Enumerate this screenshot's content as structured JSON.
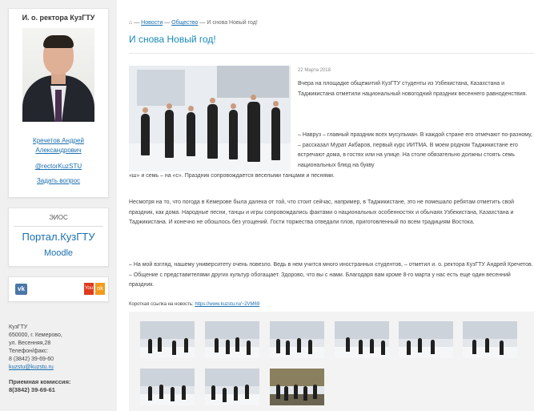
{
  "sidebar": {
    "rector": {
      "title": "И. о. ректора КузГТУ",
      "name_line1": "Кречетов Андрей",
      "name_line2": "Александрович",
      "handle": "@rectorKuzSTU",
      "ask_link": "Задать вопрос"
    },
    "eios": {
      "title": "ЭИОС",
      "portal": "Портал.КузГТУ",
      "moodle": "Moodle"
    },
    "social": {
      "vk": "vk",
      "youtube": "You",
      "ok": "ok"
    },
    "contacts": {
      "org": "КузГТУ",
      "address_line1": "650000, г. Кемерово,",
      "address_line2": "ул. Весенняя,28",
      "phone_label": "Телефон/факс:",
      "phone": "8 (3842) 39-69-60",
      "email": "kuzstu@kuzstu.ru",
      "admissions_label": "Приемная комиссия:",
      "admissions_phone": "8(3842) 39-69-61"
    }
  },
  "breadcrumb": {
    "home_icon": "home-icon",
    "sep": "—",
    "items": [
      "Новости",
      "Общество",
      "И снова Новый год!"
    ]
  },
  "article": {
    "title": "И снова Новый год!",
    "date": "22 Марта 2018",
    "p1": "Вчера на площадке общежитий КузГТУ студенты из Узбекистана, Казахстана и Таджикистана отметили национальный новогодний праздник весеннего равноденствия.",
    "p2": "– Навруз – главный праздник всех мусульман. В каждой стране его отмечают по-разному, – рассказал Мурат Акбаров, первый курс ИИТМА. В моем родном Таджикистане его встречают дома, в гостях или на улице. На столе обязательно должны стоять семь национальных блюд на букву",
    "p2_tail": "«ш» и семь – на «с». Праздник сопровождается веселыми танцами и песнями.",
    "p3": "Несмотря на то, что погода в Кемерове была далека от той, что стоит сейчас, например, в Таджикистане, это не помешало ребятам отметить свой праздник, как дома. Народные песни, танцы и игры сопровождались фактами о национальных особенностях и обычаях Узбекистана, Казахстана и Таджикистана. И конечно не обошлось без угощений. Гости торжества отведали плов, приготовленный по всем традициям Востока.",
    "p4": "– На мой взгляд, нашему университету очень повезло. Ведь в нем учится много иностранных студентов, – отметил и. о. ректора КузГТУ Андрей Кречетов. – Общение с представителями других культур обогащает. Здорово, что вы с нами. Благодаря вам кроме 8-го марта у нас есть еще один весенний праздник.",
    "short_label": "Короткая ссылка на новость:",
    "short_url": "https://www.kuzstu.ru/~2VM69"
  },
  "colors": {
    "link": "#1a6fb0",
    "title": "#1a8ab8",
    "sidebar_bg": "#f0f0f0",
    "vk": "#4a76a8",
    "youtube": "#e03a1e",
    "ok": "#f29a1c"
  }
}
